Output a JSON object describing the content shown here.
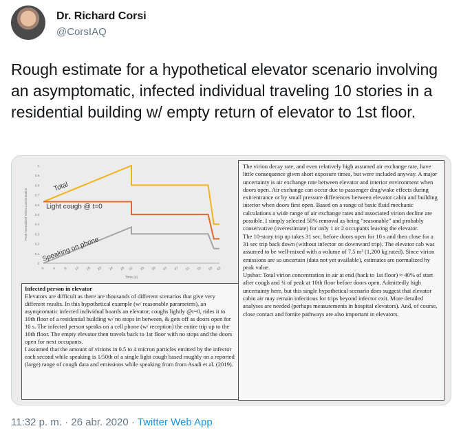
{
  "author": {
    "name": "Dr. Richard Corsi",
    "handle": "@CorsIAQ"
  },
  "tweet": {
    "text": "Rough estimate for a hypothetical elevator scenario involving an asymptomatic, infected individual traveling 10 stories in a residential building w/ empty return of elevator to 1st floor."
  },
  "chart_data": {
    "type": "line",
    "x": [
      0,
      4,
      8,
      12,
      16,
      20,
      24,
      28,
      31,
      35,
      39,
      43,
      47,
      51,
      55,
      59,
      62
    ],
    "xticks": [
      "0",
      "4",
      "8",
      "12",
      "16",
      "20",
      "24",
      "28",
      "31",
      "35",
      "39",
      "43",
      "47",
      "51",
      "55",
      "59",
      "62"
    ],
    "xlabel": "Time (s)",
    "ylabel": "Peak-Normalized Virion Concentration",
    "yticks": [
      "0",
      "0.1",
      "0.2",
      "0.3",
      "0.4",
      "0.5",
      "0.6",
      "0.7",
      "0.8",
      "0.9",
      "1"
    ],
    "ylim": [
      0,
      1
    ],
    "series": [
      {
        "name": "Total",
        "color": "#f2b21c",
        "points": [
          [
            0,
            0.63
          ],
          [
            31,
            1.0
          ],
          [
            31,
            0.8
          ],
          [
            58,
            0.8
          ],
          [
            60,
            0.4
          ],
          [
            62,
            0.4
          ]
        ]
      },
      {
        "name": "Light cough @ t=0",
        "color": "#e06a2c",
        "points": [
          [
            0,
            0.63
          ],
          [
            31,
            0.63
          ],
          [
            31,
            0.5
          ],
          [
            58,
            0.5
          ],
          [
            60,
            0.25
          ],
          [
            62,
            0.25
          ]
        ]
      },
      {
        "name": "Speaking on phone",
        "color": "#a5a5a5",
        "points": [
          [
            0,
            0.0
          ],
          [
            31,
            0.37
          ],
          [
            31,
            0.3
          ],
          [
            58,
            0.3
          ],
          [
            60,
            0.15
          ],
          [
            62,
            0.15
          ]
        ]
      }
    ]
  },
  "left_box": {
    "title": "Infected person in elevator",
    "paragraphs": [
      "Elevators are difficult as there are thousands of different scenarios that give very different results. In this hypothetical example (w/ reasonable parameters), an asymptomatic infected individual boards an elevator, coughs lightly @t=0, rides it to 10th floor of a residential building w/ no stops in between, & gets off as doors open for 10 s. The infected person speaks on a cell phone (w/ reception) the entire trip up to the 10th floor. The empty elevator then travels back to 1st floor with no stops and the doors open for next occupants.",
      "I assumed that the amount of virions in 0.5 to 4 micron particles emitted by the infector each second while speaking is 1/50th of a single light cough based roughly on a reported (large) range of cough data and emissions while speaking from from Asadi et al. (2019)."
    ]
  },
  "right_box": {
    "paragraphs": [
      "The virion decay rate, and even relatively high assumed air exchange rate, have little consequence given short exposure times, but were included anyway. A major uncertainty is air exchange rate between elevator and interior environment when doors open. Air exchange can occur due to passenger drag/wake effects during exit/entrance or by small pressure differences between elevator cabin and building interior when doors first open. Based on a range of basic fluid mechanic calculations a wide range of air exchange rates and associated virion decline are possible. I simply selected 50% removal as being \"reasonable\" and probably conservative (overestimate) for only 1 or 2 occupants leaving the elevator.",
      "The 10-story trip up takes 31 sec, before doors open for 10 s and then close for a 31 sec trip back down (without infector on downward trip). The elevator cab was assumed to be well-mixed with a volume of 7.5 m³ (1,200 kg rated). Since virion emissions are so uncertain (data not yet available), estimates are normalized by peak value.",
      "Upshot: Total virion concentration in air at end (back to 1st floor) ≈ 40% of start after cough and ¾ of peak at 10th floor before doors open. Admittedly high uncertainty here, but this single hypothetical scenario does suggest that elevator cabin air may remain infectious for trips beyond infector exit. More detailed analyses are needed (perhaps measurements in hospital elevators). And, of course, close contact and fomite pathways are also important in elevators."
    ]
  },
  "footer": {
    "time": "11:32 p. m.",
    "sep1": " · ",
    "date": "26 abr. 2020",
    "sep2": " · ",
    "app": "Twitter Web App"
  }
}
